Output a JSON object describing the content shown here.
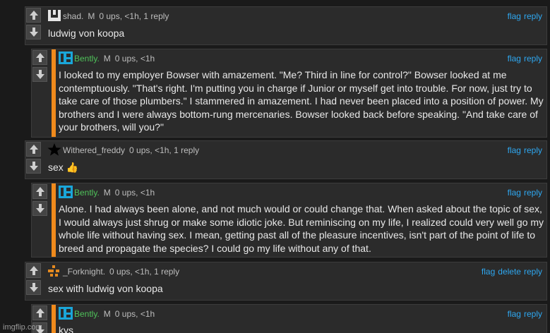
{
  "comments": [
    {
      "user": "shad.",
      "mod": "M",
      "meta": "0 ups, <1h, 1 reply",
      "actions": [
        "flag",
        "reply"
      ],
      "text": "ludwig von koopa"
    },
    {
      "user": "Bently.",
      "mod": "M",
      "meta": "0 ups, <1h",
      "actions": [
        "flag",
        "reply"
      ],
      "text": "I looked to my employer Bowser with amazement. \"Me? Third in line for control?\" Bowser looked at me contemptuously. \"That's right. I'm putting you in charge if Junior or myself get into trouble. For now, just try to take care of those plumbers.\" I stammered in amazement. I had never been placed into a position of power. My brothers and I were always bottom-rung mercenaries. Bowser looked back before speaking. \"And take care of your brothers, will you?\""
    },
    {
      "user": "Withered_freddy",
      "mod": "",
      "meta": "0 ups, <1h, 1 reply",
      "actions": [
        "flag",
        "reply"
      ],
      "text": "sex 👍"
    },
    {
      "user": "Bently.",
      "mod": "M",
      "meta": "0 ups, <1h",
      "actions": [
        "flag",
        "reply"
      ],
      "text": "Alone. I had always been alone, and not much would or could change that. When asked about the topic of sex, I would always just shrug or make some idiotic joke. But reminiscing on my life, I realized could very well go my whole life without having sex. I mean, getting past all of the pleasure incentives, isn't part of the point of life to breed and propagate the species? I could go my life without any of that."
    },
    {
      "user": "_Forknight.",
      "mod": "",
      "meta": "0 ups, <1h, 1 reply",
      "actions": [
        "flag",
        "delete",
        "reply"
      ],
      "text": "sex with ludwig von koopa"
    },
    {
      "user": "Bently.",
      "mod": "M",
      "meta": "0 ups, <1h",
      "actions": [
        "flag",
        "reply"
      ],
      "text": "kys"
    }
  ],
  "watermark": "imgflip.com",
  "colors": {
    "link": "#2ea7f0",
    "reply_bar": "#f08a1c",
    "username_green": "#4fc25a"
  }
}
